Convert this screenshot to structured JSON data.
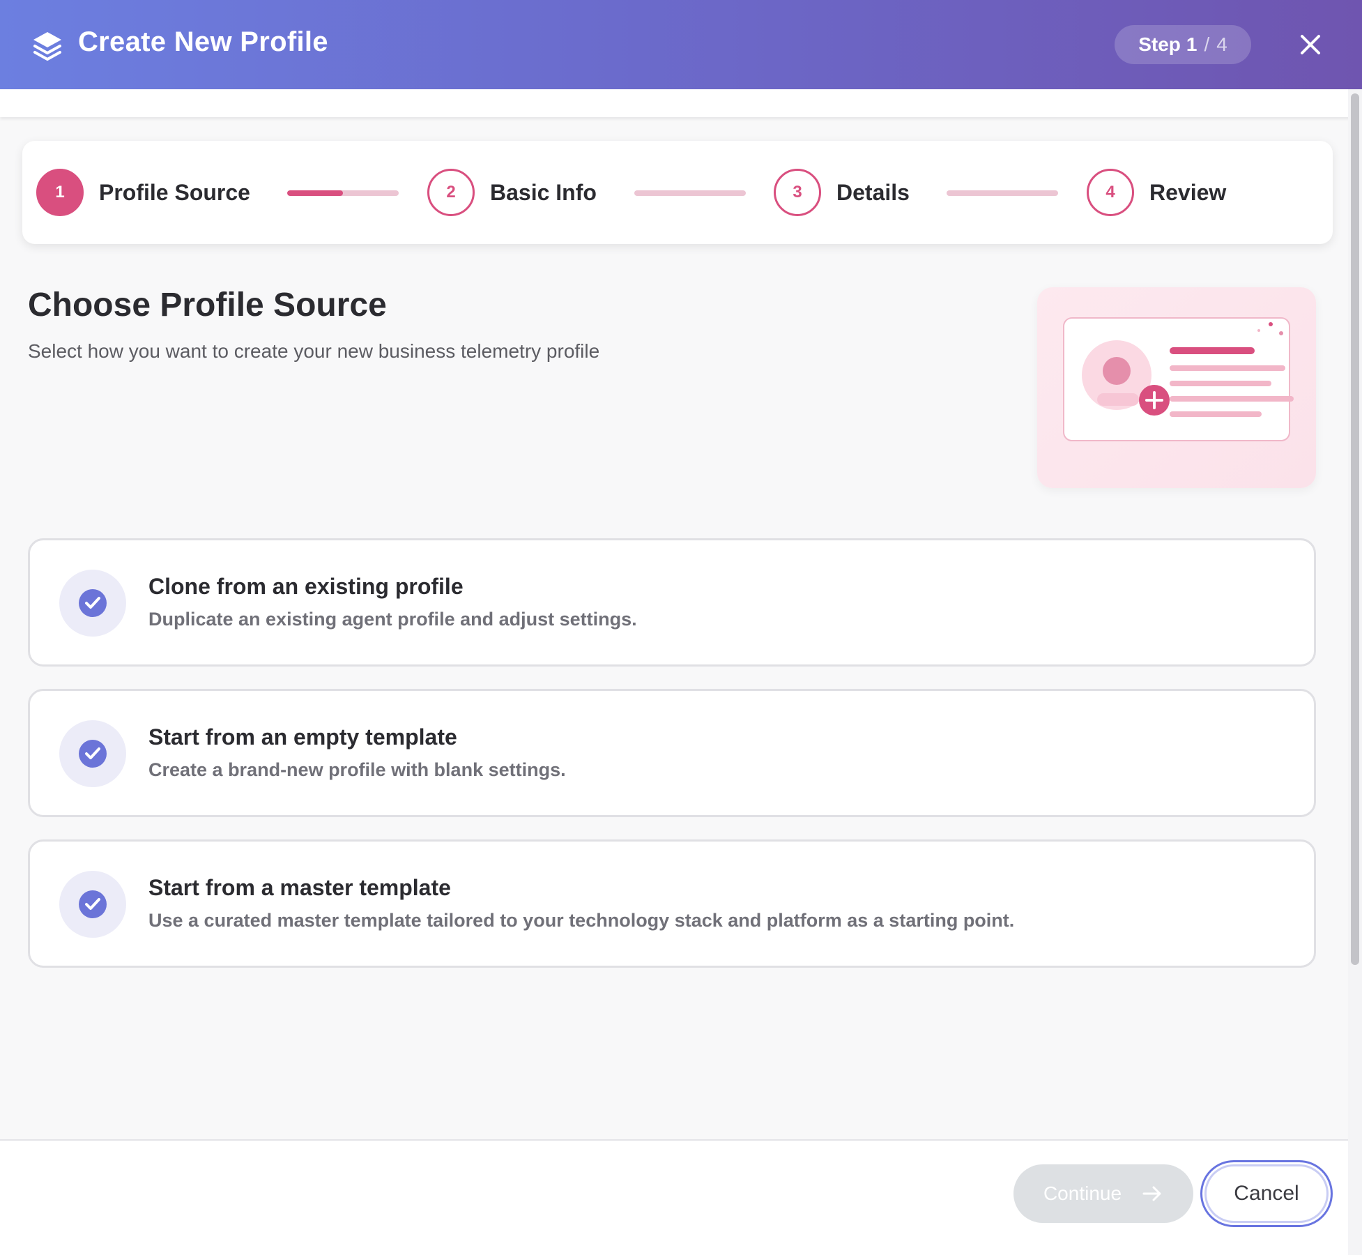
{
  "header": {
    "title": "Create New Profile",
    "icon": "layers-icon",
    "step_label": "Step",
    "step_current": "1",
    "step_separator": "/",
    "step_total": "4",
    "close_icon": "close-icon"
  },
  "stepper": {
    "steps": [
      {
        "number": "1",
        "label": "Profile Source",
        "state": "active"
      },
      {
        "number": "2",
        "label": "Basic Info",
        "state": "upcoming"
      },
      {
        "number": "3",
        "label": "Details",
        "state": "upcoming"
      },
      {
        "number": "4",
        "label": "Review",
        "state": "upcoming"
      }
    ],
    "connector_progress": [
      0.5,
      0,
      0
    ],
    "accent_color": "#d94f7f"
  },
  "main": {
    "title": "Choose Profile Source",
    "subtitle": "Select how you want to create your new business telemetry profile",
    "options": [
      {
        "title": "Clone from an existing profile",
        "description": "Duplicate an existing agent profile and adjust settings.",
        "icon": "check-circle-icon"
      },
      {
        "title": "Start from an empty template",
        "description": "Create a brand-new profile with blank settings.",
        "icon": "check-circle-icon"
      },
      {
        "title": "Start from a master template",
        "description": "Use a curated master template tailored to your technology stack and platform as a starting point.",
        "icon": "check-circle-icon"
      }
    ]
  },
  "footer": {
    "continue_label": "Continue",
    "continue_icon": "arrow-right-icon",
    "continue_disabled": true,
    "cancel_label": "Cancel"
  },
  "colors": {
    "header_gradient_start": "#6c7fe0",
    "header_gradient_end": "#6f55b0",
    "check_color": "#6b74d8",
    "cancel_border": "#6874e0"
  }
}
